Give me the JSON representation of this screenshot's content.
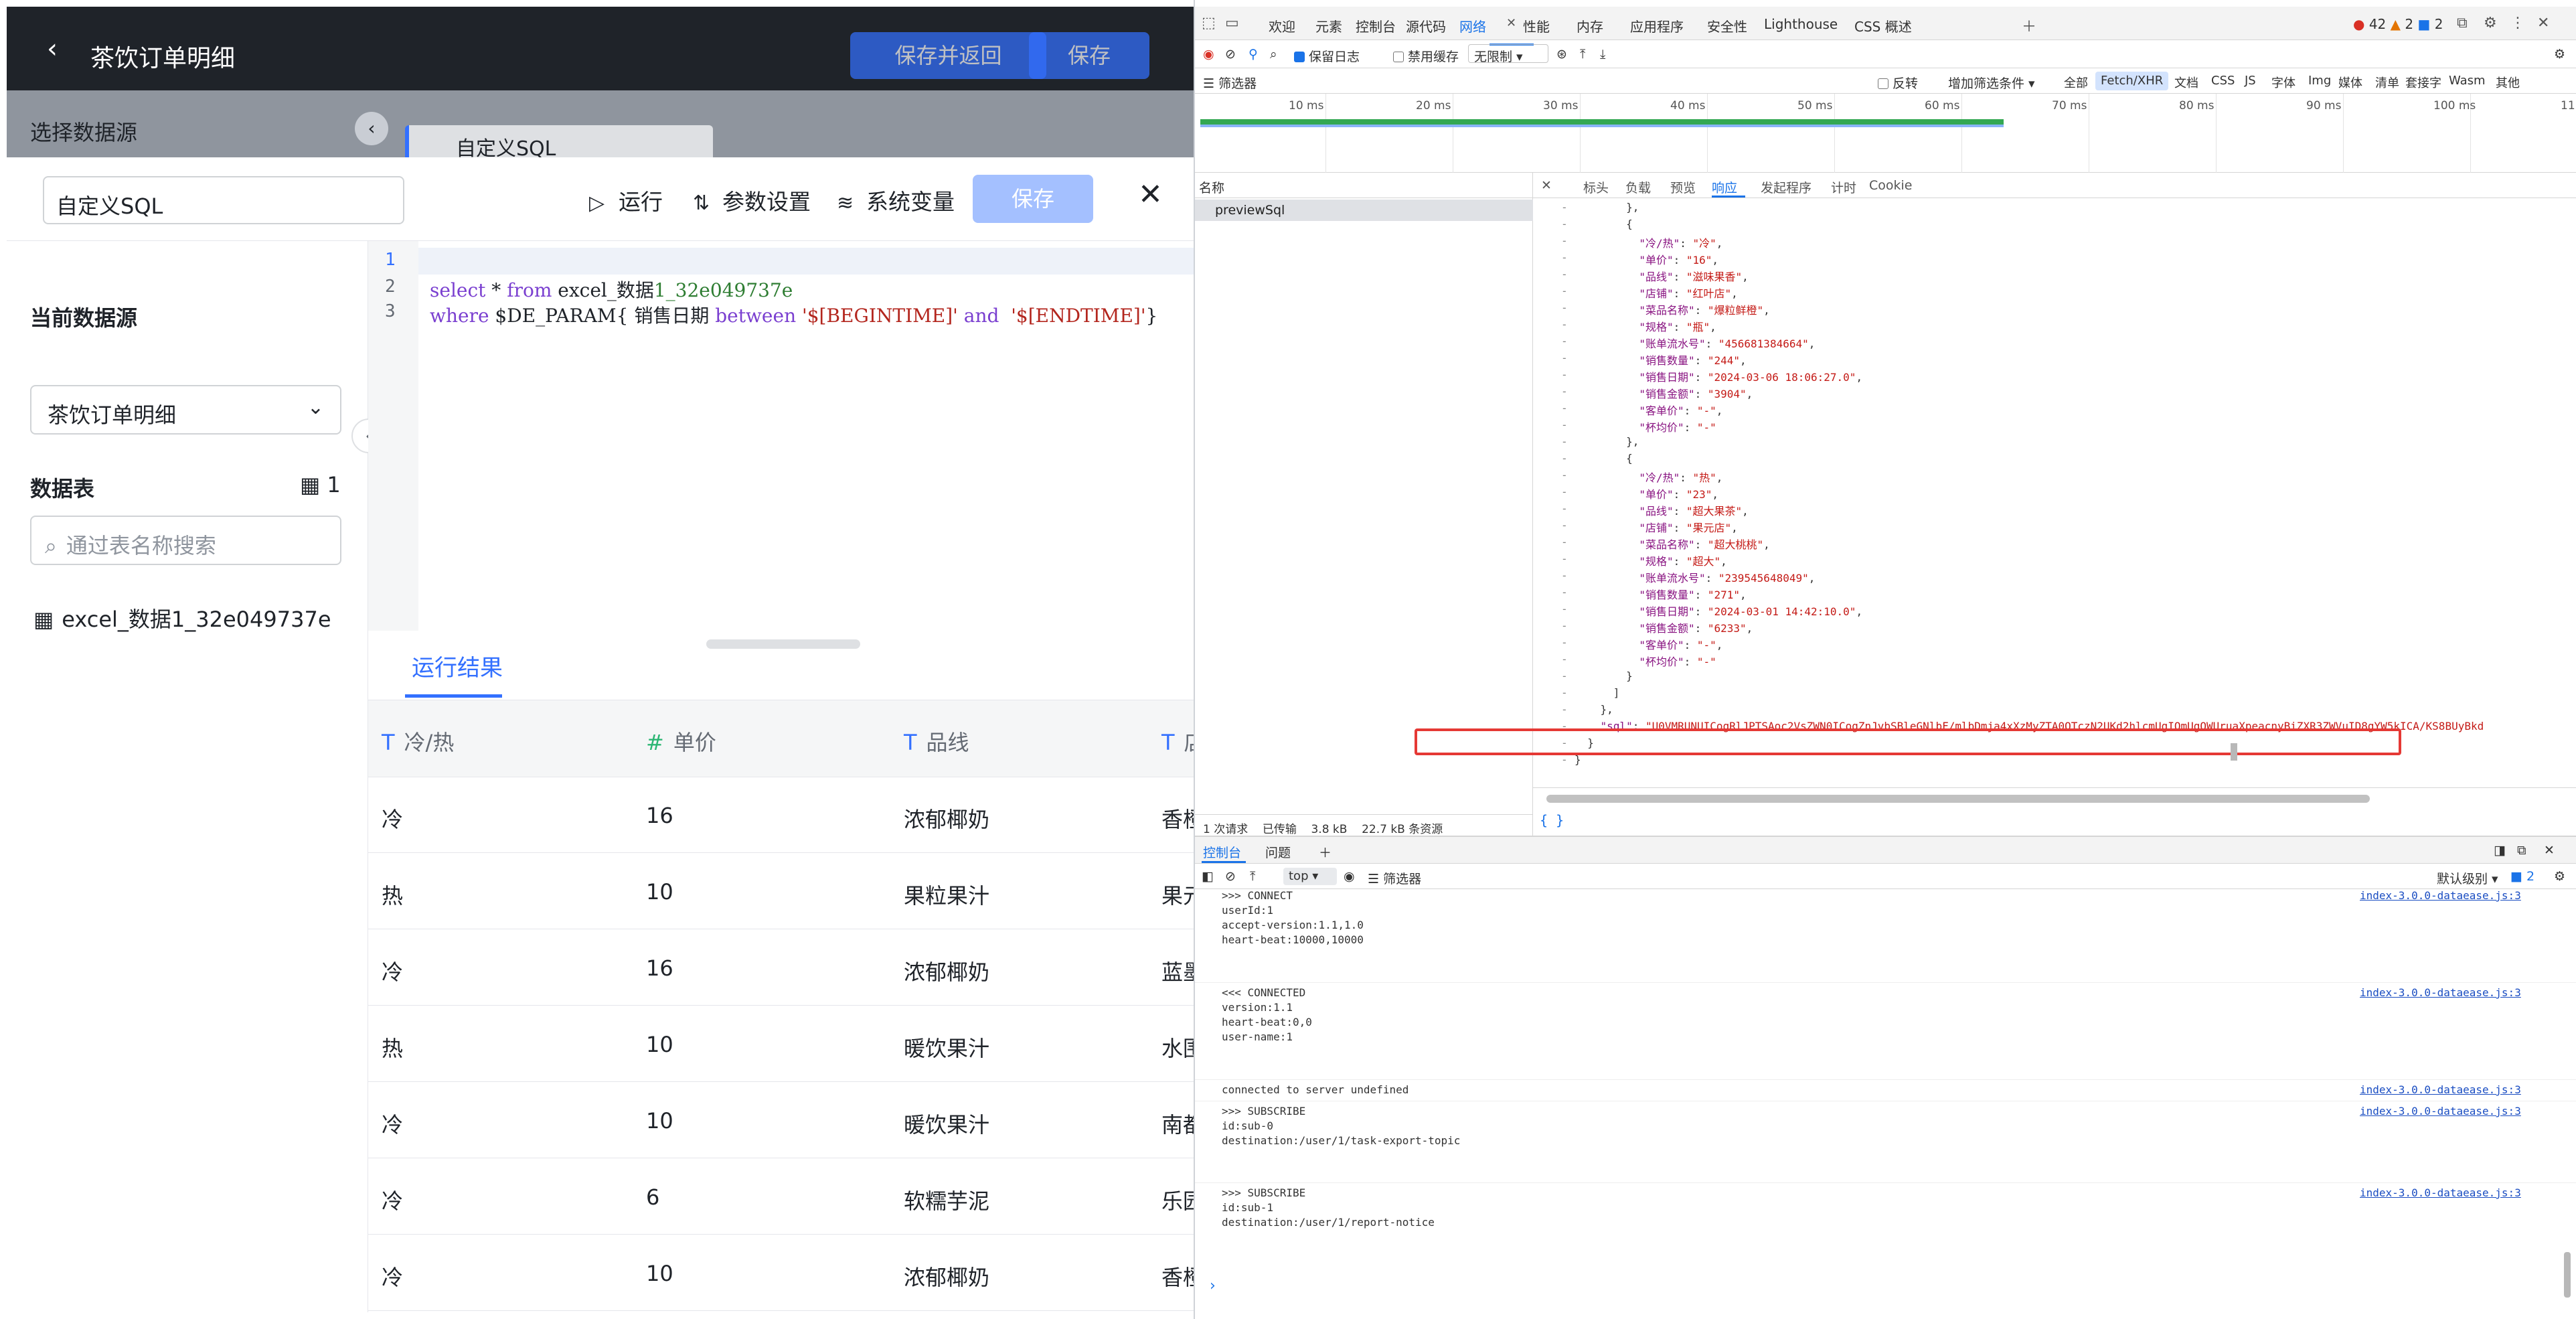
{
  "app": {
    "page_title": "茶饮订单明细",
    "save_return": "保存并返回",
    "save": "保存",
    "datasource_panel_title": "选择数据源",
    "tab_peek": "自定义SQL"
  },
  "drawer": {
    "name_value": "自定义SQL",
    "run": "运行",
    "params": "参数设置",
    "sysvars": "系统变量",
    "save": "保存",
    "current_source_label": "当前数据源",
    "current_source_value": "茶饮订单明细",
    "tables_label": "数据表",
    "tables_count": "1",
    "search_placeholder": "通过表名称搜索",
    "table_name": "excel_数据1_32e049737e"
  },
  "editor": {
    "line_numbers": [
      "1",
      "2",
      "3"
    ],
    "line2_kw1": "select",
    "line2_mid": " * ",
    "line2_kw2": "from",
    "line2_table1": " excel_数据",
    "line2_table2": "1_32e049737e",
    "line3_kw1": "where",
    "line3_param": " $DE_PARAM{ 销售日期 ",
    "line3_kw2": "between",
    "line3_s1": " '$[BEGINTIME]' ",
    "line3_kw3": "and",
    "line3_s2": "  '$[ENDTIME]'",
    "line3_end": "}"
  },
  "results": {
    "tab_label": "运行结果",
    "columns": [
      {
        "type": "T",
        "name": "冷/热"
      },
      {
        "type": "#",
        "name": "单价"
      },
      {
        "type": "T",
        "name": "品线"
      },
      {
        "type": "T",
        "name": "店"
      }
    ],
    "rows": [
      [
        "冷",
        "16",
        "浓郁椰奶",
        "香橙"
      ],
      [
        "热",
        "10",
        "果粒果汁",
        "果元"
      ],
      [
        "冷",
        "16",
        "浓郁椰奶",
        "蓝墨"
      ],
      [
        "热",
        "10",
        "暖饮果汁",
        "水围"
      ],
      [
        "冷",
        "10",
        "暖饮果汁",
        "南都"
      ],
      [
        "冷",
        "6",
        "软糯芋泥",
        "乐园"
      ],
      [
        "冷",
        "10",
        "浓郁椰奶",
        "香橙"
      ]
    ]
  },
  "devtools": {
    "top_tabs": [
      "欢迎",
      "元素",
      "控制台",
      "源代码",
      "网络",
      "性能",
      "内存",
      "应用程序",
      "安全性",
      "Lighthouse",
      "CSS 概述"
    ],
    "badges": {
      "errors": "42",
      "warnings": "2",
      "info": "2"
    },
    "net_toolbar": {
      "preserve_log": "保留日志",
      "disable_cache": "禁用缓存",
      "throttle": "无限制"
    },
    "filter": {
      "label": "筛选器",
      "invert": "反转",
      "more": "增加筛选条件"
    },
    "type_filters": [
      "全部",
      "Fetch/XHR",
      "文档",
      "CSS",
      "JS",
      "字体",
      "Img",
      "媒体",
      "清单",
      "套接字",
      "Wasm",
      "其他"
    ],
    "timeline_ticks": [
      "10 ms",
      "20 ms",
      "30 ms",
      "40 ms",
      "50 ms",
      "60 ms",
      "70 ms",
      "80 ms",
      "90 ms",
      "100 ms",
      "11"
    ],
    "name_header": "名称",
    "request": "previewSql",
    "status_bar": {
      "requests": "1 次请求",
      "transferred": "已传输",
      "size": "3.8 kB",
      "resources": "22.7 kB 条资源"
    },
    "resp_tabs": [
      "标头",
      "负载",
      "预览",
      "响应",
      "发起程序",
      "计时",
      "Cookie"
    ],
    "json_lines": [
      {
        "pre": "        },",
        "k": "",
        "v": "",
        "post": ""
      },
      {
        "pre": "        {",
        "k": "",
        "v": "",
        "post": ""
      },
      {
        "pre": "          ",
        "k": "\"冷/热\"",
        "v": "\"冷\"",
        "post": ","
      },
      {
        "pre": "          ",
        "k": "\"单价\"",
        "v": "\"16\"",
        "post": ","
      },
      {
        "pre": "          ",
        "k": "\"品线\"",
        "v": "\"滋味果香\"",
        "post": ","
      },
      {
        "pre": "          ",
        "k": "\"店铺\"",
        "v": "\"红叶店\"",
        "post": ","
      },
      {
        "pre": "          ",
        "k": "\"菜品名称\"",
        "v": "\"爆粒鲜橙\"",
        "post": ","
      },
      {
        "pre": "          ",
        "k": "\"规格\"",
        "v": "\"瓶\"",
        "post": ","
      },
      {
        "pre": "          ",
        "k": "\"账单流水号\"",
        "v": "\"456681384664\"",
        "post": ","
      },
      {
        "pre": "          ",
        "k": "\"销售数量\"",
        "v": "\"244\"",
        "post": ","
      },
      {
        "pre": "          ",
        "k": "\"销售日期\"",
        "v": "\"2024-03-06 18:06:27.0\"",
        "post": ","
      },
      {
        "pre": "          ",
        "k": "\"销售金额\"",
        "v": "\"3904\"",
        "post": ","
      },
      {
        "pre": "          ",
        "k": "\"客单价\"",
        "v": "\"-\"",
        "post": ","
      },
      {
        "pre": "          ",
        "k": "\"杯均价\"",
        "v": "\"-\"",
        "post": ""
      },
      {
        "pre": "        },",
        "k": "",
        "v": "",
        "post": ""
      },
      {
        "pre": "        {",
        "k": "",
        "v": "",
        "post": ""
      },
      {
        "pre": "          ",
        "k": "\"冷/热\"",
        "v": "\"热\"",
        "post": ","
      },
      {
        "pre": "          ",
        "k": "\"单价\"",
        "v": "\"23\"",
        "post": ","
      },
      {
        "pre": "          ",
        "k": "\"品线\"",
        "v": "\"超大果茶\"",
        "post": ","
      },
      {
        "pre": "          ",
        "k": "\"店铺\"",
        "v": "\"果元店\"",
        "post": ","
      },
      {
        "pre": "          ",
        "k": "\"菜品名称\"",
        "v": "\"超大桃桃\"",
        "post": ","
      },
      {
        "pre": "          ",
        "k": "\"规格\"",
        "v": "\"超大\"",
        "post": ","
      },
      {
        "pre": "          ",
        "k": "\"账单流水号\"",
        "v": "\"239545648049\"",
        "post": ","
      },
      {
        "pre": "          ",
        "k": "\"销售数量\"",
        "v": "\"271\"",
        "post": ","
      },
      {
        "pre": "          ",
        "k": "\"销售日期\"",
        "v": "\"2024-03-01 14:42:10.0\"",
        "post": ","
      },
      {
        "pre": "          ",
        "k": "\"销售金额\"",
        "v": "\"6233\"",
        "post": ","
      },
      {
        "pre": "          ",
        "k": "\"客单价\"",
        "v": "\"-\"",
        "post": ","
      },
      {
        "pre": "          ",
        "k": "\"杯均价\"",
        "v": "\"-\"",
        "post": ""
      },
      {
        "pre": "        }",
        "k": "",
        "v": "",
        "post": ""
      },
      {
        "pre": "      ]",
        "k": "",
        "v": "",
        "post": ""
      },
      {
        "pre": "    },",
        "k": "",
        "v": "",
        "post": ""
      },
      {
        "pre": "    ",
        "k": "\"sql\"",
        "v": "\"U0VMRUNUICogRlJPTSAoc2VsZWN0ICogZnJvbSBleGNlbF/mlbDmja4xXzMyZTA0OTczN2UKd2hlcmUgIOmUgOWUruaXpeacnyBiZXR3ZWVuID8gYW5kICA/KS8BUyBkd",
        "post": ""
      },
      {
        "pre": "  }",
        "k": "",
        "v": "",
        "post": ""
      },
      {
        "pre": "}",
        "k": "",
        "v": "",
        "post": ""
      }
    ],
    "console_tabs": [
      "控制台",
      "问题"
    ],
    "console_toolbar": {
      "context": "top",
      "filter": "筛选器",
      "level": "默认级别",
      "issues": "2"
    },
    "console_groups": [
      {
        "lines": [
          ">>> CONNECT",
          "userId:1",
          "accept-version:1.1,1.0",
          "heart-beat:10000,10000"
        ],
        "source": "index-3.0.0-dataease.js:3"
      },
      {
        "lines": [
          "<<< CONNECTED",
          "version:1.1",
          "heart-beat:0,0",
          "user-name:1"
        ],
        "source": "index-3.0.0-dataease.js:3"
      },
      {
        "lines": [
          "connected to server undefined"
        ],
        "source": "index-3.0.0-dataease.js:3"
      },
      {
        "lines": [
          ">>> SUBSCRIBE",
          "id:sub-0",
          "destination:/user/1/task-export-topic"
        ],
        "source": "index-3.0.0-dataease.js:3"
      },
      {
        "lines": [
          ">>> SUBSCRIBE",
          "id:sub-1",
          "destination:/user/1/report-notice"
        ],
        "source": "index-3.0.0-dataease.js:3"
      }
    ],
    "braces_label": "{ }",
    "prompt": "›"
  }
}
